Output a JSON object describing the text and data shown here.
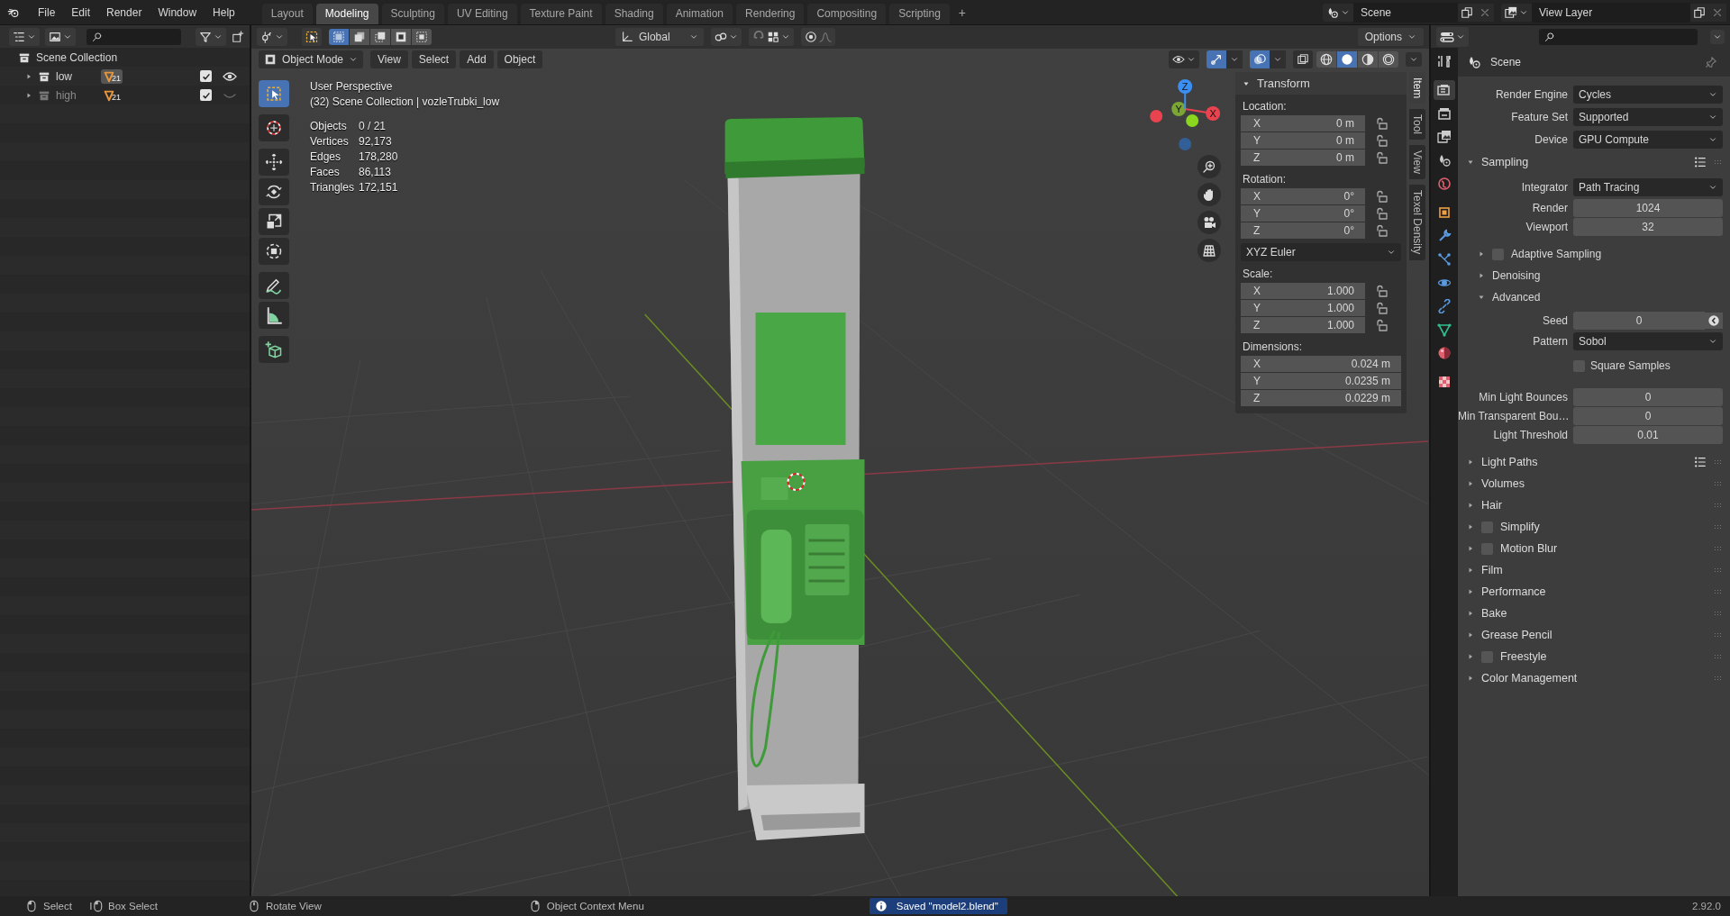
{
  "menus": [
    "File",
    "Edit",
    "Render",
    "Window",
    "Help"
  ],
  "workspaces": [
    {
      "label": "Layout",
      "selected": false
    },
    {
      "label": "Modeling",
      "selected": true
    },
    {
      "label": "Sculpting",
      "selected": false
    },
    {
      "label": "UV Editing",
      "selected": false
    },
    {
      "label": "Texture Paint",
      "selected": false
    },
    {
      "label": "Shading",
      "selected": false
    },
    {
      "label": "Animation",
      "selected": false
    },
    {
      "label": "Rendering",
      "selected": false
    },
    {
      "label": "Compositing",
      "selected": false
    },
    {
      "label": "Scripting",
      "selected": false
    }
  ],
  "add_workspace": "+",
  "scene": {
    "value": "Scene"
  },
  "view_layer": {
    "value": "View Layer"
  },
  "outliner": {
    "root": "Scene Collection",
    "collections": [
      {
        "name": "low",
        "count": "21",
        "checked": true,
        "visible": true
      },
      {
        "name": "high",
        "count": "21",
        "checked": true,
        "visible": false
      }
    ]
  },
  "viewport": {
    "select_modes": [
      {
        "selected": true
      },
      {
        "selected": false
      },
      {
        "selected": false
      },
      {
        "selected": false
      },
      {
        "selected": false
      }
    ],
    "orientation": "Global",
    "options": "Options",
    "mode": "Object Mode",
    "menus": [
      "View",
      "Select",
      "Add",
      "Object"
    ],
    "gizmos_on": true,
    "overlays_on": true,
    "shading": [
      {
        "kind": "wireframe",
        "selected": false
      },
      {
        "kind": "solid",
        "selected": true
      },
      {
        "kind": "material",
        "selected": false
      },
      {
        "kind": "rendered",
        "selected": false
      }
    ],
    "tool_groups": [
      [
        {
          "kind": "select",
          "selected": true
        }
      ],
      [
        {
          "kind": "cursor",
          "selected": false
        }
      ],
      [
        {
          "kind": "move",
          "selected": false
        },
        {
          "kind": "rotate",
          "selected": false
        },
        {
          "kind": "scale",
          "selected": false
        },
        {
          "kind": "transform",
          "selected": false
        }
      ],
      [
        {
          "kind": "annotate",
          "selected": false
        },
        {
          "kind": "measure",
          "selected": false
        }
      ],
      [
        {
          "kind": "add_cube",
          "selected": false
        }
      ]
    ],
    "view_name": "User Perspective",
    "context": "(32) Scene Collection | vozleTrubki_low",
    "stats": [
      {
        "label": "Objects",
        "value": "0 / 21"
      },
      {
        "label": "Vertices",
        "value": "92,173"
      },
      {
        "label": "Edges",
        "value": "178,280"
      },
      {
        "label": "Faces",
        "value": "86,113"
      },
      {
        "label": "Triangles",
        "value": "172,151"
      }
    ],
    "axis_labels": [
      "X",
      "Y",
      "Z"
    ]
  },
  "sidebar": {
    "tabs": [
      {
        "label": "Item",
        "selected": true
      },
      {
        "label": "Tool",
        "selected": false
      },
      {
        "label": "View",
        "selected": false
      },
      {
        "label": "Texel Density",
        "selected": false
      }
    ],
    "panel": "Transform",
    "groups": [
      {
        "label": "Location:",
        "locks": true,
        "fields": [
          {
            "axis": "X",
            "value": "0 m"
          },
          {
            "axis": "Y",
            "value": "0 m"
          },
          {
            "axis": "Z",
            "value": "0 m"
          }
        ]
      },
      {
        "label": "Rotation:",
        "locks": true,
        "dropdown": "XYZ Euler",
        "fields": [
          {
            "axis": "X",
            "value": "0°"
          },
          {
            "axis": "Y",
            "value": "0°"
          },
          {
            "axis": "Z",
            "value": "0°"
          }
        ]
      },
      {
        "label": "Scale:",
        "locks": true,
        "fields": [
          {
            "axis": "X",
            "value": "1.000"
          },
          {
            "axis": "Y",
            "value": "1.000"
          },
          {
            "axis": "Z",
            "value": "1.000"
          }
        ]
      },
      {
        "label": "Dimensions:",
        "locks": false,
        "fields": [
          {
            "axis": "X",
            "value": "0.024 m"
          },
          {
            "axis": "Y",
            "value": "0.0235 m"
          },
          {
            "axis": "Z",
            "value": "0.0229 m"
          }
        ]
      }
    ]
  },
  "properties": {
    "tabs": [
      {
        "kind": "tool",
        "selected": false
      },
      {
        "kind": "render",
        "selected": true
      },
      {
        "kind": "output",
        "selected": false
      },
      {
        "kind": "view_layer",
        "selected": false
      },
      {
        "kind": "scene",
        "selected": false
      },
      {
        "kind": "world",
        "selected": false
      },
      {
        "kind": "object",
        "selected": false
      },
      {
        "kind": "modifiers",
        "selected": false
      },
      {
        "kind": "particles",
        "selected": false
      },
      {
        "kind": "physics",
        "selected": false
      },
      {
        "kind": "constraints",
        "selected": false
      },
      {
        "kind": "data",
        "selected": false
      },
      {
        "kind": "material",
        "selected": false
      },
      {
        "kind": "texture",
        "selected": false
      }
    ],
    "context": "Scene",
    "rows": [
      {
        "kind": "dropdown",
        "label": "Render Engine",
        "value": "Cycles"
      },
      {
        "kind": "dropdown",
        "label": "Feature Set",
        "value": "Supported"
      },
      {
        "kind": "dropdown",
        "label": "Device",
        "value": "GPU Compute"
      },
      {
        "kind": "panel",
        "label": "Sampling",
        "expanded": true,
        "presets": true
      },
      {
        "kind": "dropdown",
        "label": "Integrator",
        "value": "Path Tracing"
      },
      {
        "kind": "number",
        "label": "Render",
        "value": "1024"
      },
      {
        "kind": "number",
        "label": "Viewport",
        "value": "32"
      },
      {
        "kind": "subpanel",
        "label": "Adaptive Sampling",
        "expanded": false,
        "checked": false
      },
      {
        "kind": "subpanel",
        "label": "Denoising",
        "expanded": false
      },
      {
        "kind": "subpanel",
        "label": "Advanced",
        "expanded": true
      },
      {
        "kind": "seed",
        "label": "Seed",
        "value": "0"
      },
      {
        "kind": "dropdown",
        "label": "Pattern",
        "value": "Sobol"
      },
      {
        "kind": "checkbox",
        "label": "Square Samples",
        "checked": false
      },
      {
        "kind": "number",
        "label": "Min Light Bounces",
        "value": "0"
      },
      {
        "kind": "number",
        "label": "Min Transparent Bou…",
        "value": "0"
      },
      {
        "kind": "number",
        "label": "Light Threshold",
        "value": "0.01"
      },
      {
        "kind": "panel",
        "label": "Light Paths",
        "expanded": false,
        "presets": true
      },
      {
        "kind": "panel",
        "label": "Volumes",
        "expanded": false
      },
      {
        "kind": "panel",
        "label": "Hair",
        "expanded": false
      },
      {
        "kind": "panel",
        "label": "Simplify",
        "expanded": false,
        "checked": false
      },
      {
        "kind": "panel",
        "label": "Motion Blur",
        "expanded": false,
        "checked": false
      },
      {
        "kind": "panel",
        "label": "Film",
        "expanded": false
      },
      {
        "kind": "panel",
        "label": "Performance",
        "expanded": false
      },
      {
        "kind": "panel",
        "label": "Bake",
        "expanded": false
      },
      {
        "kind": "panel",
        "label": "Grease Pencil",
        "expanded": false
      },
      {
        "kind": "panel",
        "label": "Freestyle",
        "expanded": false,
        "checked": false
      },
      {
        "kind": "panel",
        "label": "Color Management",
        "expanded": false
      }
    ]
  },
  "status": {
    "items": [
      {
        "kind": "left",
        "label": "Select"
      },
      {
        "kind": "left_drag",
        "label": "Box Select"
      },
      {
        "kind": "middle",
        "label": "Rotate View"
      },
      {
        "kind": "right",
        "label": "Object Context Menu"
      }
    ],
    "message": "Saved \"model2.blend\"",
    "version": "2.92.0"
  }
}
